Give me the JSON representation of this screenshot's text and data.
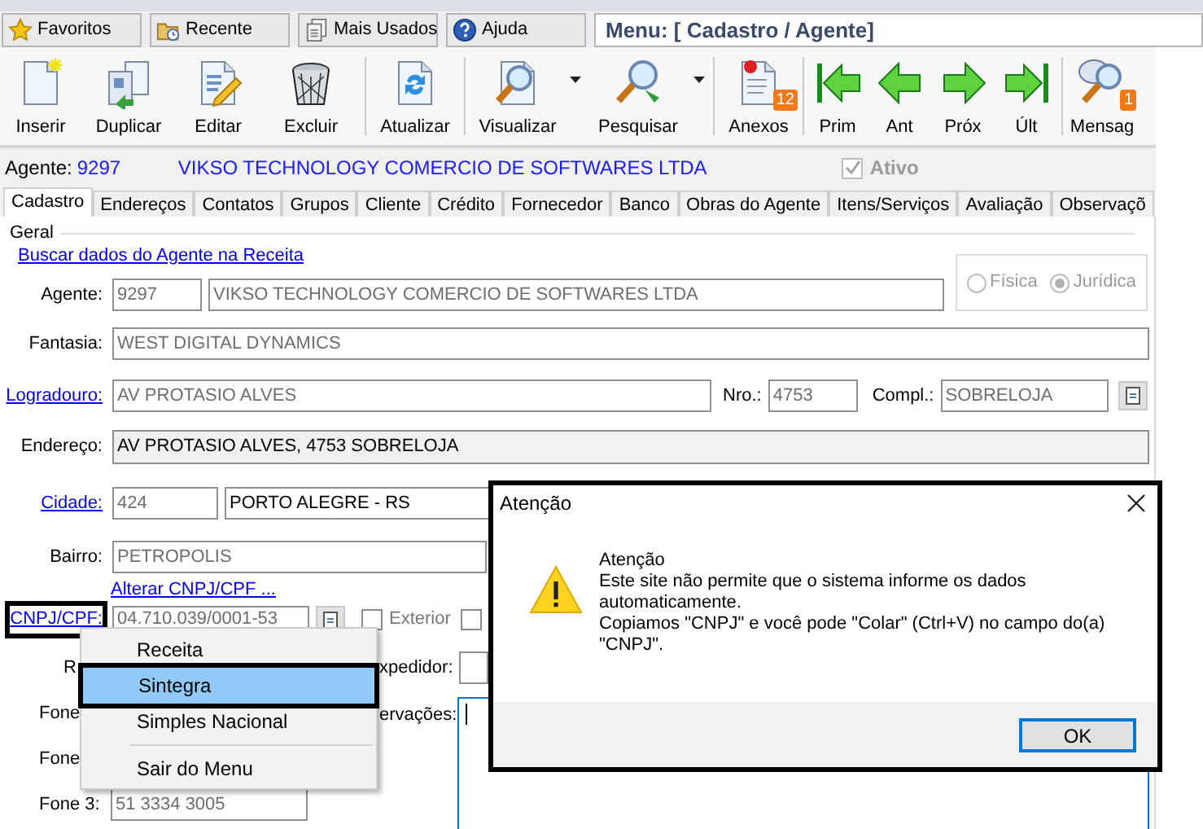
{
  "top_tabs": [
    {
      "label": "Favoritos"
    },
    {
      "label": "Recente"
    },
    {
      "label": "Mais Usados"
    },
    {
      "label": "Ajuda"
    }
  ],
  "menu_title": "Menu: [ Cadastro / Agente]",
  "toolbar_groups": [
    [
      {
        "label": "Inserir",
        "has_menu": false
      },
      {
        "label": "Duplicar",
        "has_menu": false
      },
      {
        "label": "Editar",
        "has_menu": false
      },
      {
        "label": "Excluir",
        "has_menu": false
      }
    ],
    [
      {
        "label": "Atualizar",
        "has_menu": false
      }
    ],
    [
      {
        "label": "Visualizar",
        "has_menu": true
      },
      {
        "label": "Pesquisar",
        "has_menu": true
      }
    ],
    [
      {
        "label": "Anexos",
        "has_menu": false,
        "badge": "12"
      }
    ],
    [
      {
        "label": "Prim",
        "has_menu": false
      },
      {
        "label": "Ant",
        "has_menu": false
      },
      {
        "label": "Próx",
        "has_menu": false
      },
      {
        "label": "Últ",
        "has_menu": false
      }
    ],
    [
      {
        "label": "Mensag",
        "has_menu": false,
        "badge": "1"
      }
    ]
  ],
  "header": {
    "label": "Agente:",
    "code": "9297",
    "name": "VIKSO TECHNOLOGY COMERCIO DE SOFTWARES LTDA",
    "active": {
      "label": "Ativo",
      "checked": true,
      "disabled": true
    }
  },
  "tabs": [
    {
      "label": "Cadastro",
      "selected": true
    },
    {
      "label": "Endereços",
      "selected": false
    },
    {
      "label": "Contatos",
      "selected": false
    },
    {
      "label": "Grupos",
      "selected": false
    },
    {
      "label": "Cliente",
      "selected": false
    },
    {
      "label": "Crédito",
      "selected": false
    },
    {
      "label": "Fornecedor",
      "selected": false
    },
    {
      "label": "Banco",
      "selected": false
    },
    {
      "label": "Obras do Agente",
      "selected": false
    },
    {
      "label": "Itens/Serviços",
      "selected": false
    },
    {
      "label": "Avaliação",
      "selected": false
    },
    {
      "label": "Observaçõ",
      "selected": false
    }
  ],
  "form": {
    "group": "Geral",
    "lookup_link": "Buscar dados do Agente na Receita",
    "agente": {
      "label": "Agente:",
      "link": false,
      "code": "9297",
      "name": "VIKSO TECHNOLOGY COMERCIO DE SOFTWARES LTDA",
      "disabled": true
    },
    "person_type": [
      {
        "label": "Física",
        "selected": false
      },
      {
        "label": "Jurídica",
        "selected": true
      }
    ],
    "fantasia": {
      "label": "Fantasia:",
      "link": false,
      "value": "WEST DIGITAL DYNAMICS",
      "disabled": true
    },
    "logradouro": {
      "label": "Logradouro:",
      "link": true,
      "value": "AV PROTASIO ALVES",
      "disabled": true
    },
    "numero": {
      "label": "Nro.:",
      "value": "4753",
      "disabled": true
    },
    "complemento": {
      "label": "Compl.:",
      "value": "SOBRELOJA",
      "disabled": true
    },
    "endereco": {
      "label": "Endereço:",
      "link": false,
      "value": "AV PROTASIO ALVES, 4753 SOBRELOJA",
      "readonly": true
    },
    "cidade": {
      "label": "Cidade:",
      "link": true,
      "code": "424",
      "code_disabled": true,
      "name": "PORTO ALEGRE - RS",
      "name_disabled": false
    },
    "bairro": {
      "label": "Bairro:",
      "link": false,
      "value": "PETROPOLIS",
      "disabled": true
    },
    "change_doc_link": "Alterar CNPJ/CPF ...",
    "cnpj": {
      "label": "CNPJ/CPF:",
      "link": true,
      "highlighted": true,
      "value": "04.710.039/0001-53",
      "disabled": true
    },
    "exterior": {
      "label": "Exterior",
      "checked": false
    },
    "second_checkbox": {
      "checked": false
    },
    "rg_label": "R",
    "expedidor_label": "xpedidor:",
    "phones": [
      {
        "label": "Fone"
      },
      {
        "label": "Fone"
      },
      {
        "label": "Fone 3:",
        "value": "51 3334 3005",
        "disabled": true
      }
    ],
    "observacoes_label": "ervações:"
  },
  "context_menu": [
    {
      "label": "Receita",
      "selected": false,
      "separator_before": false
    },
    {
      "label": "Sintegra",
      "selected": true,
      "separator_before": false
    },
    {
      "label": "Simples Nacional",
      "selected": false,
      "separator_before": false
    },
    {
      "label": "Sair do Menu",
      "selected": false,
      "separator_before": true
    }
  ],
  "dialog": {
    "title": "Atenção",
    "heading": "Atenção",
    "message": "Este site não permite que o sistema informe os dados\nautomaticamente.\nCopiamos \"CNPJ\" e você pode \"Colar\" (Ctrl+V) no campo do(a)\n\"CNPJ\".",
    "button": "OK"
  }
}
